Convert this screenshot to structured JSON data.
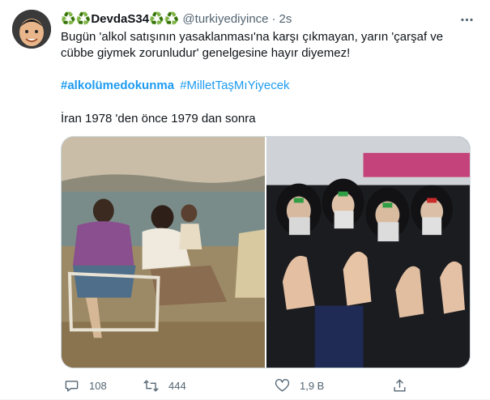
{
  "tweet": {
    "display_name": "♻️♻️DevdaS34♻️♻️",
    "handle": "@turkiyediyince",
    "separator": "·",
    "time": "2s",
    "text_line1": "Bugün 'alkol satışının yasaklanması'na karşı çıkmayan, yarın 'çarşaf ve cübbe giymek zorunludur' genelgesine hayır diyemez!",
    "hashtag1": "#alkolümedokunma",
    "hashtag2": "#MilletTaşMıYiyecek",
    "text_line3": "İran 1978 'den önce 1979 dan sonra",
    "media": [
      {
        "subject": "women-1978-photo"
      },
      {
        "subject": "women-1979-photo"
      }
    ]
  },
  "actions": {
    "reply_count": "108",
    "retweet_count": "444",
    "like_count": "1,9 B",
    "share_label": ""
  },
  "colors": {
    "accent": "#1d9bf0",
    "secondary_text": "#536471",
    "primary_text": "#0f1419",
    "border": "#cfd9de"
  }
}
